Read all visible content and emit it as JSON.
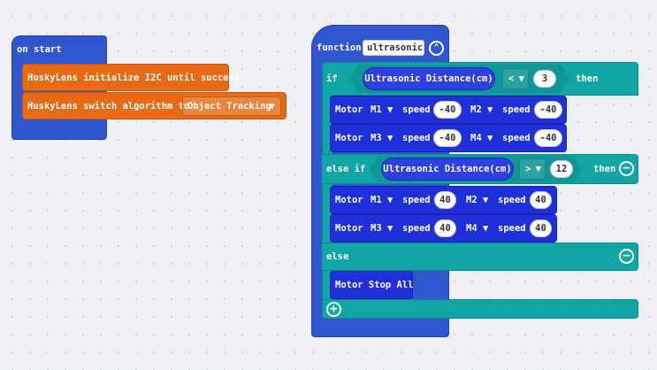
{
  "on_start": {
    "hat_label": "on start",
    "init_block": "HuskyLens initialize I2C until success",
    "switch_block": "HuskyLens switch algorithm to",
    "algorithm_value": "Object Tracking"
  },
  "function_block": {
    "label": "function",
    "name": "ultrasonic",
    "if_label": "if",
    "then_label": "then",
    "else_if_label": "else if",
    "else_label": "else",
    "condition1": {
      "reporter": "Ultrasonic Distance(cm)",
      "operator": "<",
      "value": "3"
    },
    "condition2": {
      "reporter": "Ultrasonic Distance(cm)",
      "operator": ">",
      "value": "12"
    },
    "if_branch": [
      {
        "motor_label": "Motor",
        "m_a": "M1",
        "speed_label_a": "speed",
        "speed_a": "-40",
        "m_b": "M2",
        "speed_label_b": "speed",
        "speed_b": "-40"
      },
      {
        "motor_label": "Motor",
        "m_a": "M3",
        "speed_label_a": "speed",
        "speed_a": "-40",
        "m_b": "M4",
        "speed_label_b": "speed",
        "speed_b": "-40"
      }
    ],
    "else_if_branch": [
      {
        "motor_label": "Motor",
        "m_a": "M1",
        "speed_label_a": "speed",
        "speed_a": "40",
        "m_b": "M2",
        "speed_label_b": "speed",
        "speed_b": "40"
      },
      {
        "motor_label": "Motor",
        "m_a": "M3",
        "speed_label_a": "speed",
        "speed_a": "40",
        "m_b": "M4",
        "speed_label_b": "speed",
        "speed_b": "40"
      }
    ],
    "else_branch_block": "Motor Stop All"
  },
  "colors": {
    "basic_blue": "#2f55cf",
    "huskylens_orange": "#e86a15",
    "logic_teal": "#11a5a5",
    "motor_blue": "#1f2fd9"
  },
  "icons": {
    "dropdown": "caret-down-icon",
    "collapse": "chevron-up-icon",
    "remove": "minus-circle-icon",
    "add": "plus-circle-icon"
  }
}
